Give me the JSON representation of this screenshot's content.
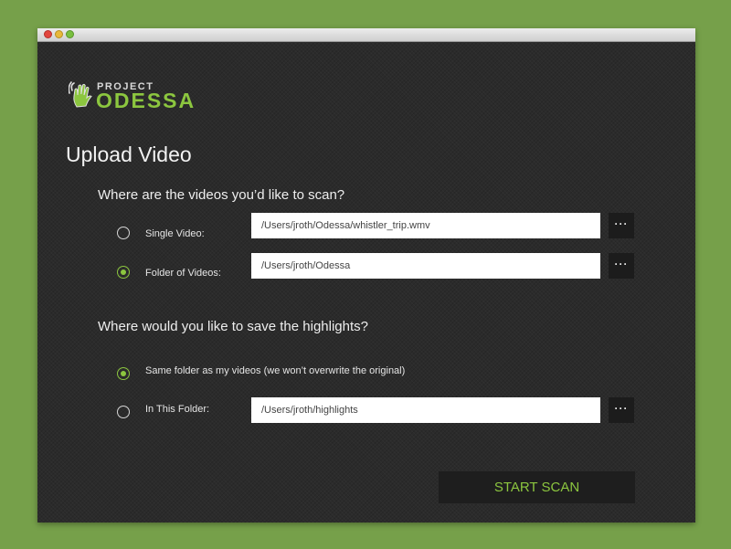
{
  "window": {
    "controls": [
      "close",
      "minimize",
      "zoom"
    ]
  },
  "logo": {
    "project_text": "PROJECT",
    "name_text": "ODESSA",
    "accent_color": "#8cc63f",
    "icon": "hand-wave-icon"
  },
  "page": {
    "title": "Upload Video"
  },
  "scan_section": {
    "question": "Where are the videos you’d like to scan?",
    "options": [
      {
        "label": "Single Video:",
        "path": "/Users/jroth/Odessa/whistler_trip.wmv",
        "selected": false,
        "browse_label": "···"
      },
      {
        "label": "Folder of Videos:",
        "path": "/Users/jroth/Odessa",
        "selected": true,
        "browse_label": "···"
      }
    ]
  },
  "save_section": {
    "question": "Where would you like to save the highlights?",
    "same_folder": {
      "label": "Same folder as my videos (we won’t overwrite the original)",
      "selected": true
    },
    "custom_folder": {
      "label": "In This Folder:",
      "path": "/Users/jroth/highlights",
      "selected": false,
      "browse_label": "···"
    }
  },
  "actions": {
    "start_scan_label": "START SCAN"
  }
}
